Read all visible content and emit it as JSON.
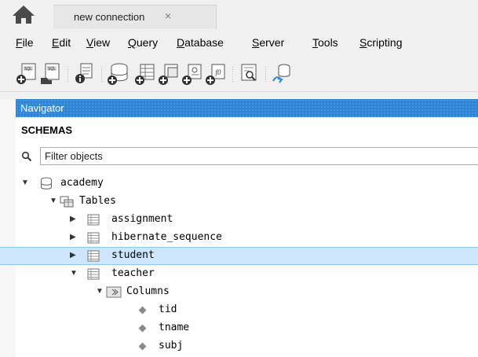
{
  "tab": {
    "title": "new connection",
    "close": "×"
  },
  "menu": {
    "items": [
      {
        "first": "F",
        "rest": "ile"
      },
      {
        "first": "E",
        "rest": "dit"
      },
      {
        "first": "V",
        "rest": "iew"
      },
      {
        "first": "Q",
        "rest": "uery"
      },
      {
        "first": "D",
        "rest": "atabase"
      },
      {
        "first": "S",
        "rest": "erver"
      },
      {
        "first": "T",
        "rest": "ools"
      },
      {
        "first": "S",
        "rest": "cripting"
      }
    ]
  },
  "navigator": {
    "title": "Navigator",
    "section": "SCHEMAS",
    "filter_placeholder": "Filter objects"
  },
  "tree": {
    "schema": "academy",
    "tables_label": "Tables",
    "tables": [
      "assignment",
      "hibernate_sequence",
      "student",
      "teacher"
    ],
    "columns_label": "Columns",
    "columns": [
      "tid",
      "tname",
      "subj"
    ],
    "selected": "student"
  },
  "colors": {
    "accent": "#2f86d6",
    "selection": "#cde6fb"
  }
}
